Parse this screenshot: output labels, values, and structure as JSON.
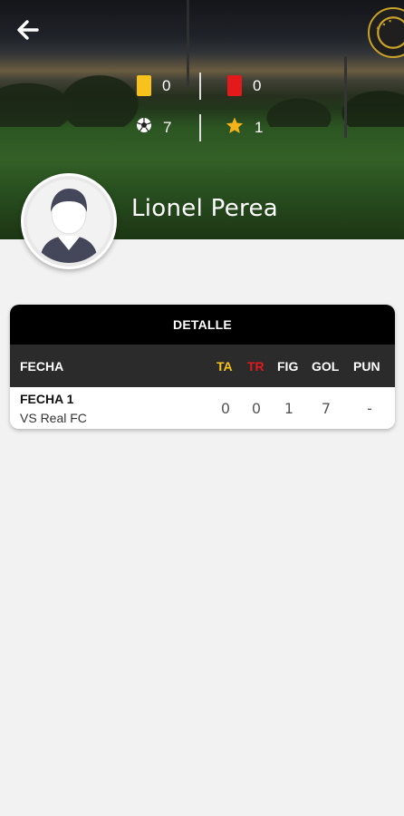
{
  "player": {
    "name": "Lionel Perea"
  },
  "stats": {
    "yellow_cards": "0",
    "red_cards": "0",
    "goals": "7",
    "mvp": "1"
  },
  "icons": {
    "back": "arrow-left-icon",
    "yellow_card": "yellow-card-icon",
    "red_card": "red-card-icon",
    "goals": "soccer-ball-icon",
    "mvp": "star-icon",
    "avatar": "user-silhouette-icon"
  },
  "colors": {
    "ta": "#f7c21c",
    "tr": "#e3191b",
    "star": "#f6b21a"
  },
  "detail": {
    "title": "DETALLE",
    "columns": {
      "fecha": "FECHA",
      "ta": "TA",
      "tr": "TR",
      "fig": "FIG",
      "gol": "GOL",
      "pun": "PUN"
    },
    "rows": [
      {
        "fecha": "FECHA 1",
        "rival": "VS Real FC",
        "ta": "0",
        "tr": "0",
        "fig": "1",
        "gol": "7",
        "pun": "-"
      }
    ]
  }
}
